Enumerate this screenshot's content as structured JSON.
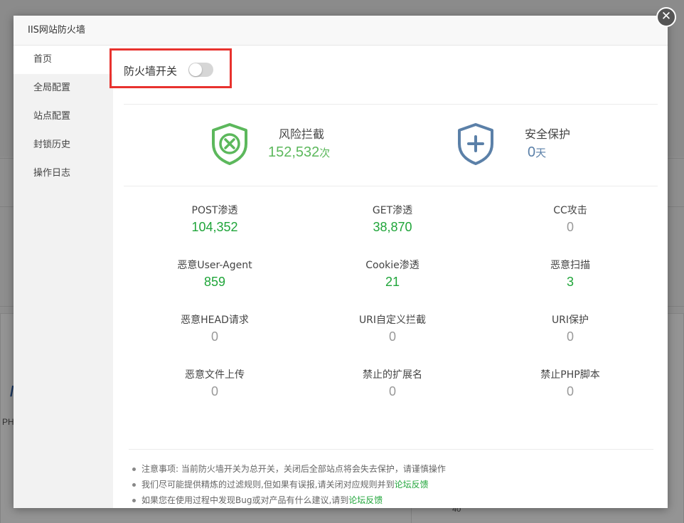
{
  "background": {
    "label_php": "PH",
    "axis_value": "40"
  },
  "modal": {
    "title": "IIS网站防火墙",
    "close_icon": "close-icon"
  },
  "sidebar": {
    "items": [
      {
        "label": "首页",
        "active": true
      },
      {
        "label": "全局配置",
        "active": false
      },
      {
        "label": "站点配置",
        "active": false
      },
      {
        "label": "封锁历史",
        "active": false
      },
      {
        "label": "操作日志",
        "active": false
      }
    ]
  },
  "firewall_switch": {
    "label": "防火墙开关",
    "enabled": false
  },
  "summary": {
    "risk": {
      "icon": "shield-x-icon",
      "title": "风险拦截",
      "value": "152,532",
      "unit": "次",
      "color": "#5cb85c"
    },
    "protect": {
      "icon": "shield-plus-icon",
      "title": "安全保护",
      "value": "0",
      "unit": "天",
      "color": "#5b80a8"
    }
  },
  "stats": [
    {
      "label": "POST渗透",
      "value": "104,352",
      "status": "green"
    },
    {
      "label": "GET渗透",
      "value": "38,870",
      "status": "green"
    },
    {
      "label": "CC攻击",
      "value": "0",
      "status": "grey"
    },
    {
      "label": "恶意User-Agent",
      "value": "859",
      "status": "green"
    },
    {
      "label": "Cookie渗透",
      "value": "21",
      "status": "green"
    },
    {
      "label": "恶意扫描",
      "value": "3",
      "status": "green"
    },
    {
      "label": "恶意HEAD请求",
      "value": "0",
      "status": "grey"
    },
    {
      "label": "URI自定义拦截",
      "value": "0",
      "status": "grey"
    },
    {
      "label": "URI保护",
      "value": "0",
      "status": "grey"
    },
    {
      "label": "恶意文件上传",
      "value": "0",
      "status": "grey"
    },
    {
      "label": "禁止的扩展名",
      "value": "0",
      "status": "grey"
    },
    {
      "label": "禁止PHP脚本",
      "value": "0",
      "status": "grey"
    }
  ],
  "notes": [
    {
      "text": "注意事项: 当前防火墙开关为总开关，关闭后全部站点将会失去保护，请谨慎操作",
      "link": ""
    },
    {
      "text": "我们尽可能提供精炼的过滤规则,但如果有误报,请关闭对应规则并到",
      "link": "论坛反馈"
    },
    {
      "text": "如果您在使用过程中发现Bug或对产品有什么建议,请到",
      "link": "论坛反馈"
    }
  ],
  "colors": {
    "accent_green": "#20a53a",
    "highlight_red": "#e8322e"
  }
}
